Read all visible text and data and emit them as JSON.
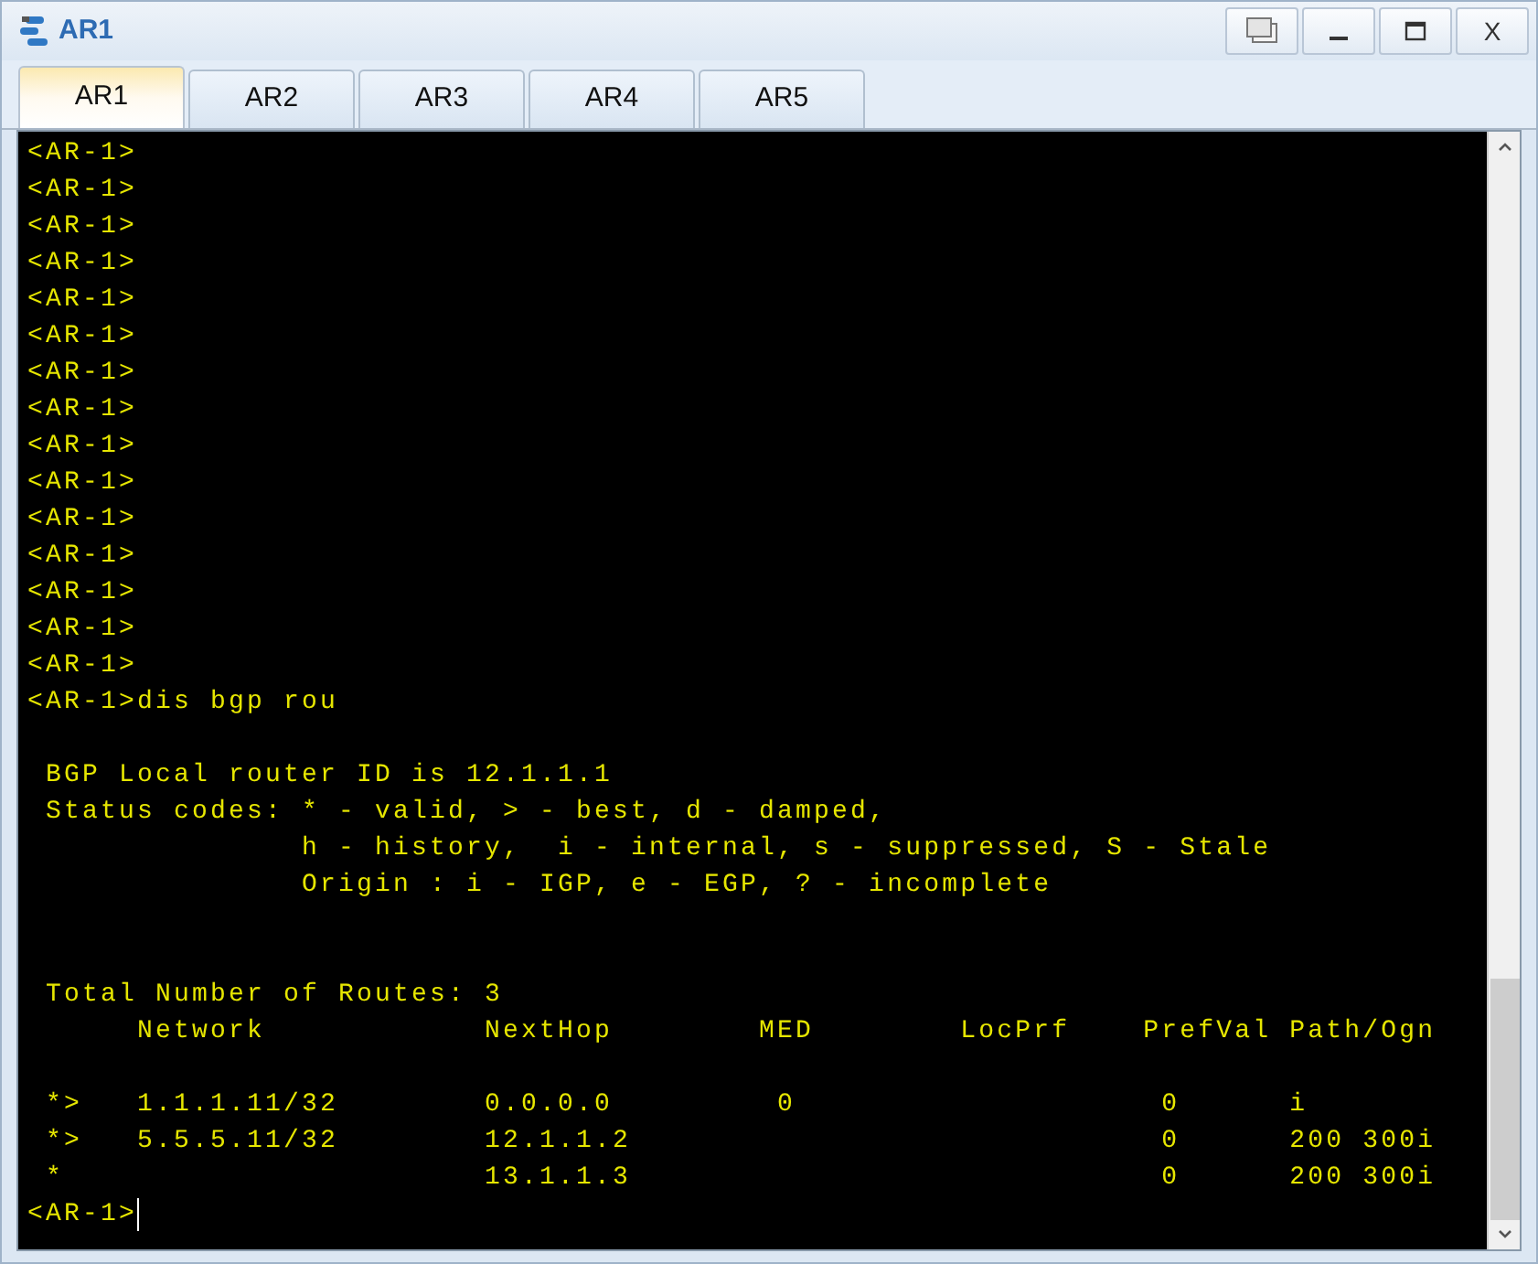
{
  "window": {
    "title": "AR1",
    "buttons": [
      {
        "kind": "restore"
      },
      {
        "kind": "minimize"
      },
      {
        "kind": "maximize"
      },
      {
        "kind": "close",
        "label": "X"
      }
    ]
  },
  "tabs": [
    {
      "label": "AR1",
      "selected": true
    },
    {
      "label": "AR2",
      "selected": false
    },
    {
      "label": "AR3",
      "selected": false
    },
    {
      "label": "AR4",
      "selected": false
    },
    {
      "label": "AR5",
      "selected": false
    }
  ],
  "terminal": {
    "lines": [
      {
        "kind": "text",
        "text": "<AR-1>"
      },
      {
        "kind": "text",
        "text": "<AR-1>"
      },
      {
        "kind": "text",
        "text": "<AR-1>"
      },
      {
        "kind": "text",
        "text": "<AR-1>"
      },
      {
        "kind": "text",
        "text": "<AR-1>"
      },
      {
        "kind": "text",
        "text": "<AR-1>"
      },
      {
        "kind": "text",
        "text": "<AR-1>"
      },
      {
        "kind": "text",
        "text": "<AR-1>"
      },
      {
        "kind": "text",
        "text": "<AR-1>"
      },
      {
        "kind": "text",
        "text": "<AR-1>"
      },
      {
        "kind": "text",
        "text": "<AR-1>"
      },
      {
        "kind": "text",
        "text": "<AR-1>"
      },
      {
        "kind": "text",
        "text": "<AR-1>"
      },
      {
        "kind": "text",
        "text": "<AR-1>"
      },
      {
        "kind": "text",
        "text": "<AR-1>"
      },
      {
        "kind": "text",
        "text": "<AR-1>dis bgp rou"
      },
      {
        "kind": "blank"
      },
      {
        "kind": "text",
        "text": " BGP Local router ID is 12.1.1.1"
      },
      {
        "kind": "text",
        "text": " Status codes: * - valid, > - best, d - damped,"
      },
      {
        "kind": "text",
        "text": "               h - history,  i - internal, s - suppressed, S - Stale"
      },
      {
        "kind": "text",
        "text": "               Origin : i - IGP, e - EGP, ? - incomplete"
      },
      {
        "kind": "blank"
      },
      {
        "kind": "blank"
      },
      {
        "kind": "text",
        "text": " Total Number of Routes: 3"
      },
      {
        "kind": "text",
        "text": "      Network            NextHop        MED        LocPrf    PrefVal Path/Ogn"
      },
      {
        "kind": "blank"
      },
      {
        "kind": "text",
        "text": " *>   1.1.1.11/32        0.0.0.0         0                    0      i"
      },
      {
        "kind": "text",
        "text": " *>   5.5.5.11/32        12.1.1.2                             0      200 300i"
      },
      {
        "kind": "text",
        "text": " *                       13.1.1.3                             0      200 300i"
      },
      {
        "kind": "prompt",
        "text": "<AR-1>",
        "cursor": true
      }
    ]
  }
}
